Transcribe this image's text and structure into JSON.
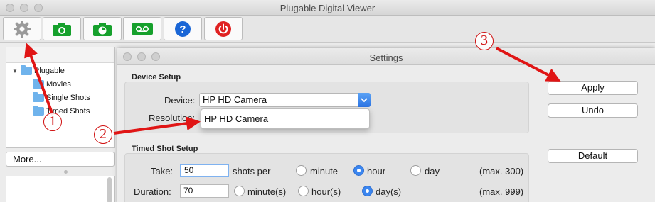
{
  "main_window": {
    "title": "Plugable Digital Viewer",
    "toolbar": [
      {
        "name": "settings-button",
        "icon": "gear-icon"
      },
      {
        "name": "capture-photo-button",
        "icon": "camera-icon"
      },
      {
        "name": "timed-capture-button",
        "icon": "timer-camera-icon"
      },
      {
        "name": "record-video-button",
        "icon": "video-record-icon"
      },
      {
        "name": "help-button",
        "icon": "help-icon"
      },
      {
        "name": "power-button",
        "icon": "power-icon"
      }
    ],
    "colors": {
      "green": "#16a02c",
      "blue": "#1a66d6",
      "red": "#e02121"
    }
  },
  "sidebar": {
    "root": "Plugable",
    "folders": [
      "Movies",
      "Single Shots",
      "Timed Shots"
    ],
    "more_label": "More..."
  },
  "settings": {
    "title": "Settings",
    "device_setup": {
      "heading": "Device Setup",
      "device_label": "Device:",
      "device_value": "HP HD Camera",
      "resolution_label": "Resolution:",
      "dropdown_option": "HP HD Camera"
    },
    "timed_shot": {
      "heading": "Timed Shot Setup",
      "take_label": "Take:",
      "take_value": "50",
      "shots_per": "shots per",
      "take_options": [
        "minute",
        "hour",
        "day"
      ],
      "take_selected": "hour",
      "take_max": "(max. 300)",
      "duration_label": "Duration:",
      "duration_value": "70",
      "duration_options": [
        "minute(s)",
        "hour(s)",
        "day(s)"
      ],
      "duration_selected": "day(s)",
      "duration_max": "(max. 999)"
    },
    "buttons": {
      "apply": "Apply",
      "undo": "Undo",
      "default": "Default"
    }
  },
  "annotations": {
    "one": "1",
    "two": "2",
    "three": "3",
    "color": "#e01515"
  }
}
